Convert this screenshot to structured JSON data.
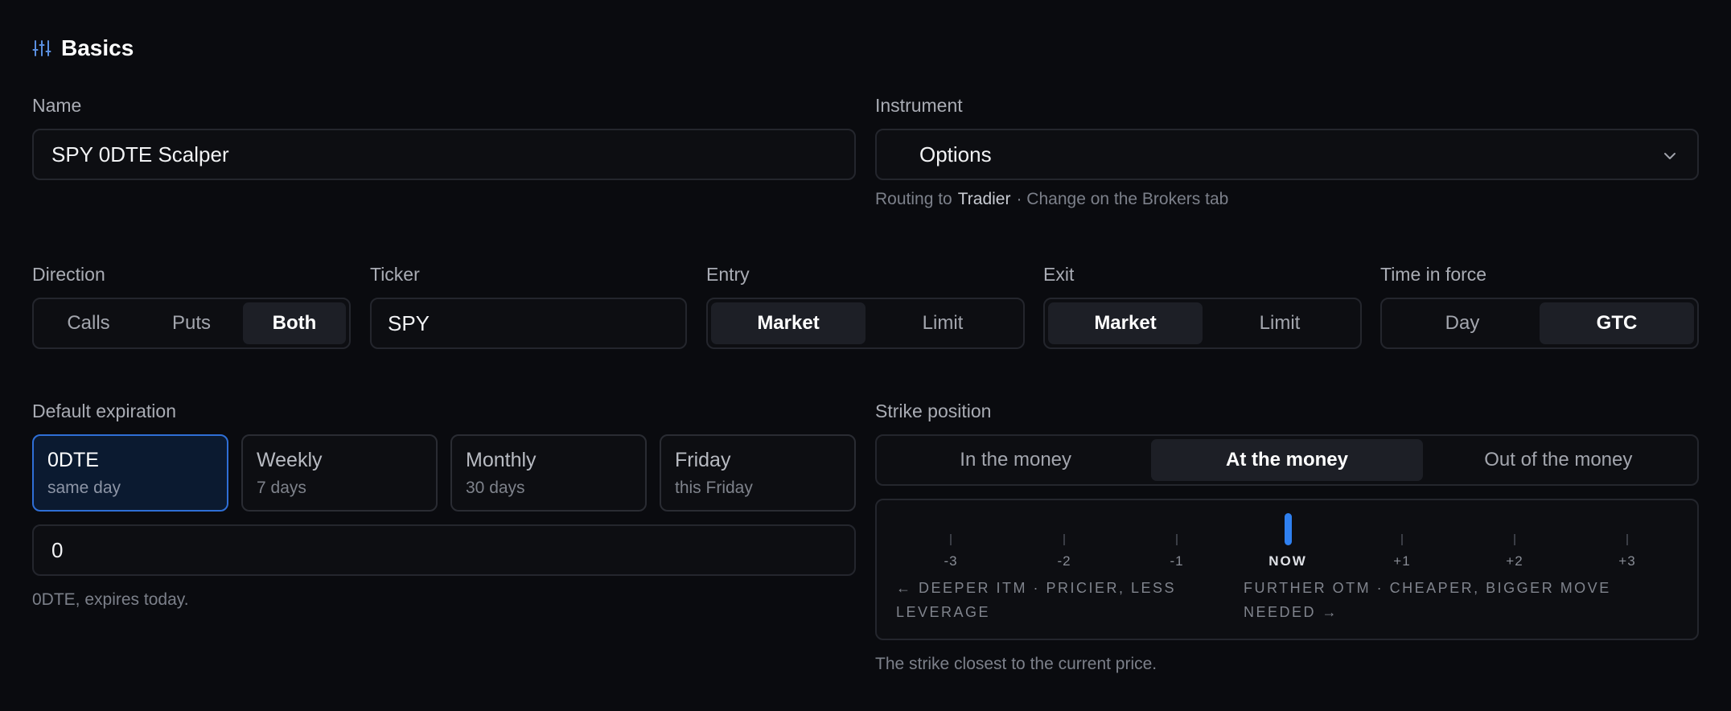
{
  "section": {
    "title": "Basics",
    "icon": "sliders-icon"
  },
  "name": {
    "label": "Name",
    "value": "SPY 0DTE Scalper"
  },
  "instrument": {
    "label": "Instrument",
    "value": "Options",
    "helper_prefix": "Routing to",
    "broker": "Tradier",
    "helper_suffix": "· Change on the Brokers tab"
  },
  "direction": {
    "label": "Direction",
    "options": [
      "Calls",
      "Puts",
      "Both"
    ],
    "selected": "Both"
  },
  "ticker": {
    "label": "Ticker",
    "value": "SPY"
  },
  "entry": {
    "label": "Entry",
    "options": [
      "Market",
      "Limit"
    ],
    "selected": "Market"
  },
  "exit": {
    "label": "Exit",
    "options": [
      "Market",
      "Limit"
    ],
    "selected": "Market"
  },
  "time_in_force": {
    "label": "Time in force",
    "options": [
      "Day",
      "GTC"
    ],
    "selected": "GTC"
  },
  "expiration": {
    "label": "Default expiration",
    "cards": [
      {
        "title": "0DTE",
        "sub": "same day"
      },
      {
        "title": "Weekly",
        "sub": "7 days"
      },
      {
        "title": "Monthly",
        "sub": "30 days"
      },
      {
        "title": "Friday",
        "sub": "this Friday"
      }
    ],
    "selected": "0DTE",
    "days_value": "0",
    "helper": "0DTE, expires today."
  },
  "strike": {
    "label": "Strike position",
    "options": [
      "In the money",
      "At the money",
      "Out of the money"
    ],
    "selected": "At the money",
    "ticks": [
      "-3",
      "-2",
      "-1",
      "NOW",
      "+1",
      "+2",
      "+3"
    ],
    "left_note": "← DEEPER ITM · PRICIER, LESS LEVERAGE",
    "right_note": "FURTHER OTM · CHEAPER, BIGGER MOVE NEEDED →",
    "helper": "The strike closest to the current price."
  },
  "colors": {
    "accent": "#2f80f0",
    "background": "#0a0b0f",
    "border": "#24262d"
  }
}
